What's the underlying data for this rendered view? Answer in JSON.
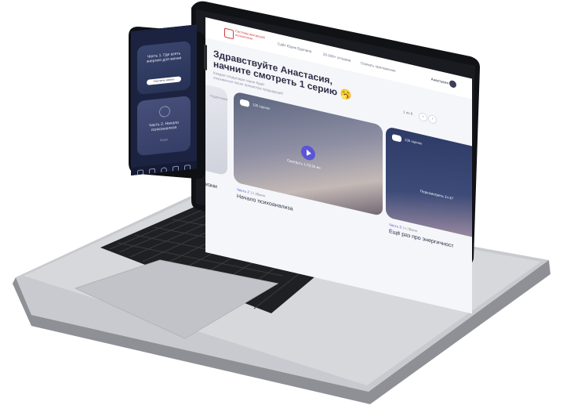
{
  "colors": {
    "accent": "#5b55d6",
    "brand": "#d33a3a",
    "background": "#f5f6f9",
    "phone_background": "#1c2340"
  },
  "nav": {
    "logo_text": "Система авторской психологии",
    "links": [
      "Сайт Юрия Бурлана",
      "20 000+ отзывов",
      "Скачать приложение"
    ],
    "user_name": "Анастасия"
  },
  "hero": {
    "greeting_line1": "Здравствуйте Анастасия,",
    "greeting_line2": "начните смотреть 1 серию",
    "emoji": "🥱",
    "subtitle": "Каждая следующая серия будет открываться после просмотра предыдущей"
  },
  "pager": {
    "text": "1 из 6",
    "prev": "‹",
    "next": "›"
  },
  "cards": {
    "prev": {
      "hint": "Подготовка",
      "title": "изни"
    },
    "main": {
      "badge_text": "135 оценок",
      "watch_label": "Смотреть 1:23:34 ин",
      "part_label": "Часть 2",
      "duration": "1ч 38мин",
      "title": "Начало психоанализа"
    },
    "next": {
      "badge_text": "135 оценок",
      "watch_label": "Пересмотреть 1ч 47",
      "part_label": "Часть 3",
      "duration": "1ч 28мин",
      "title": "Ещё раз про энергичност"
    }
  },
  "phone": {
    "card1_text": "Часть 1. Где взять энергию для жизни",
    "card1_button": "Смотреть запись",
    "card2_text": "Часть 2. Начало психоанализа",
    "card2_sub": "Скоро",
    "tabs": [
      "home-icon",
      "search-icon",
      "user-icon",
      "note-icon",
      "list-icon"
    ]
  }
}
